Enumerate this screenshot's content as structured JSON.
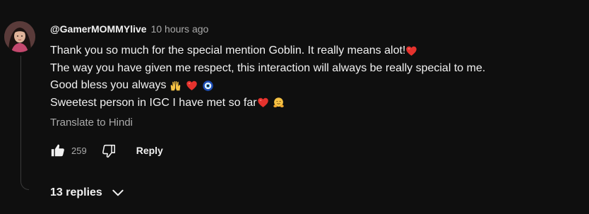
{
  "comment": {
    "author": "@GamerMOMMYlive",
    "timestamp": "10 hours ago",
    "lines": [
      {
        "text": "Thank you so much for the special mention Goblin. It really means alot!",
        "emojis": [
          "red-heart"
        ]
      },
      {
        "text": "The way you have given me respect, this interaction will always be really special to me.",
        "emojis": []
      },
      {
        "text": "Good bless you always ",
        "emojis": [
          "raising-hands",
          "red-heart",
          "nazar-amulet"
        ]
      },
      {
        "text": "Sweetest person in IGC I have met so far",
        "emojis": [
          "red-heart",
          "hugging-face"
        ]
      }
    ],
    "translate_label": "Translate to Hindi",
    "like_count": "259",
    "reply_label": "Reply",
    "replies_label": "13 replies"
  },
  "icons": {
    "like": "thumbs-up-icon",
    "dislike": "thumbs-down-icon",
    "expand": "chevron-down-icon"
  },
  "colors": {
    "background": "#0f0f0f",
    "text_primary": "#f1f1f1",
    "text_secondary": "#aaaaaa",
    "heart": "#e5322d"
  }
}
